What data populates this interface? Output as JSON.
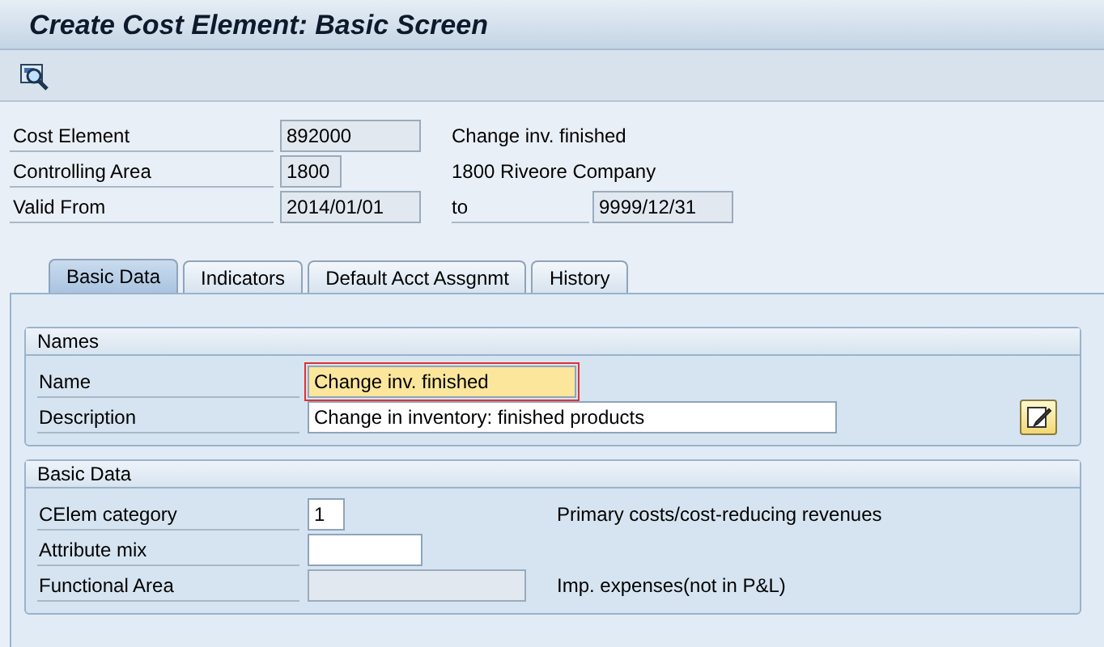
{
  "window": {
    "title": "Create Cost Element: Basic Screen"
  },
  "header_fields": [
    {
      "label": "Cost Element",
      "value": "892000",
      "disabled": true,
      "text": "Change inv. finished"
    },
    {
      "label": "Controlling Area",
      "value": "1800",
      "disabled": true,
      "text": "1800 Riveore Company"
    },
    {
      "label": "Valid From",
      "value": "2014/01/01",
      "disabled": true,
      "to_label": "to",
      "to_value": "9999/12/31",
      "to_disabled": true
    }
  ],
  "tabs": [
    {
      "label": "Basic Data",
      "selected": true
    },
    {
      "label": "Indicators",
      "selected": false
    },
    {
      "label": "Default Acct Assgnmt",
      "selected": false
    },
    {
      "label": "History",
      "selected": false
    }
  ],
  "groups": [
    {
      "title": "Names",
      "fields": [
        {
          "label": "Name",
          "value": "Change inv. finished",
          "disabled": false,
          "focused": true
        },
        {
          "label": "Description",
          "value": "Change in inventory: finished products",
          "disabled": false,
          "focused": false
        }
      ]
    },
    {
      "title": "Basic Data",
      "fields": [
        {
          "label": "CElem category",
          "value": "1",
          "disabled": false,
          "focused": false,
          "text": "Primary costs/cost-reducing revenues"
        },
        {
          "label": "Attribute mix",
          "disabled": false,
          "focused": false
        },
        {
          "label": "Functional Area",
          "disabled": true,
          "focused": false,
          "text": "Imp. expenses(not in P&L)"
        }
      ]
    }
  ]
}
